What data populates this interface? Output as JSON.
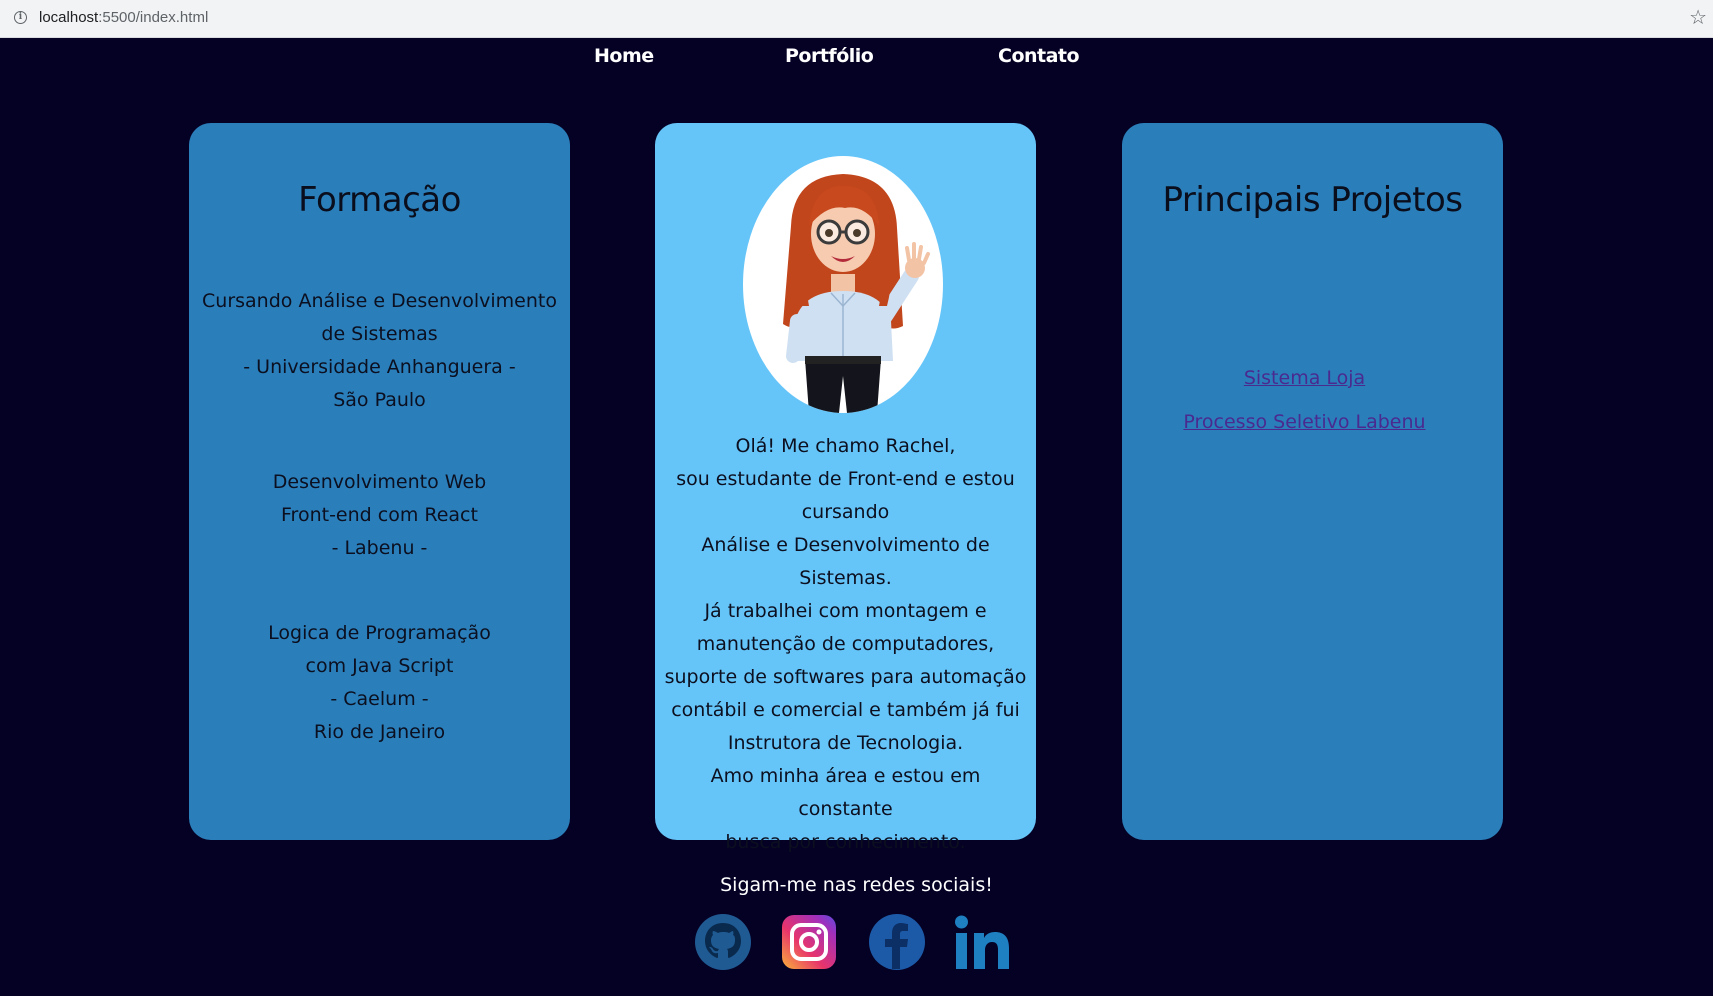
{
  "browser": {
    "url_host": "localhost",
    "url_path": ":5500/index.html"
  },
  "nav": {
    "home": "Home",
    "portfolio": "Portfólio",
    "contact": "Contato"
  },
  "formacao": {
    "title": "Formação",
    "items": [
      [
        "Cursando Análise e Desenvolvimento",
        "de Sistemas",
        "- Universidade Anhanguera -",
        "São Paulo"
      ],
      [
        "Desenvolvimento Web",
        "Front-end com React",
        "- Labenu -"
      ],
      [
        "Logica de Programação",
        "com Java Script",
        "- Caelum -",
        "Rio de Janeiro"
      ]
    ]
  },
  "about": {
    "lines": [
      "Olá! Me chamo Rachel,",
      "sou estudante de Front-end e estou",
      "cursando",
      "Análise e Desenvolvimento de",
      "Sistemas.",
      "Já trabalhei com montagem e",
      "manutenção de computadores,",
      "suporte de softwares para automação",
      "contábil e comercial e também já fui",
      "Instrutora de Tecnologia.",
      "Amo minha área e estou em constante",
      "busca por conhecimento."
    ]
  },
  "projetos": {
    "title": "Principais Projetos",
    "links": [
      "Sistema Loja",
      "Processo Seletivo Labenu"
    ]
  },
  "social": {
    "title": "Sigam-me nas redes sociais!",
    "icons": [
      "github-icon",
      "instagram-icon",
      "facebook-icon",
      "linkedin-icon"
    ]
  },
  "colors": {
    "background": "#050125",
    "card_dark": "#2a7fbb",
    "card_light": "#66c5f8",
    "link": "#4a2a8f"
  }
}
